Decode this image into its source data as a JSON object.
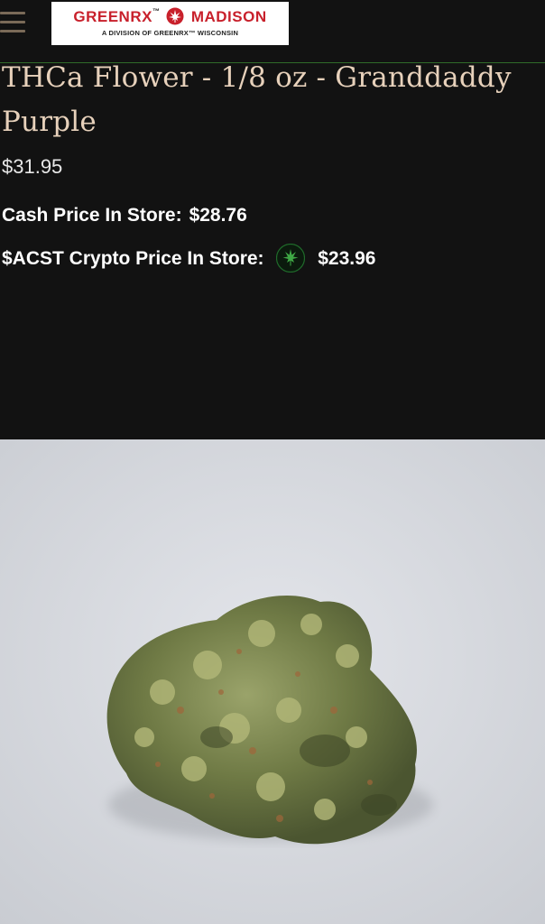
{
  "header": {
    "logo": {
      "brand_left": "GREENRX",
      "trademark": "™",
      "brand_right": "MADISON",
      "subtitle": "A DIVISION OF GREENRX™ WISCONSIN"
    }
  },
  "product": {
    "title": "THCa Flower - 1/8 oz - Granddaddy Purple",
    "price": "$31.95",
    "cash_label": "Cash Price In Store:",
    "cash_value": "$28.76",
    "crypto_label": "$ACST Crypto Price In Store:",
    "crypto_value": "$23.96"
  },
  "colors": {
    "background": "#121212",
    "title": "#e7d1bb",
    "brand_red": "#c8202b",
    "accent_green": "#2f6b2a"
  },
  "icons": {
    "menu": "hamburger-menu-icon",
    "logo_leaf": "cannabis-leaf-icon",
    "crypto_coin": "acst-coin-icon"
  }
}
